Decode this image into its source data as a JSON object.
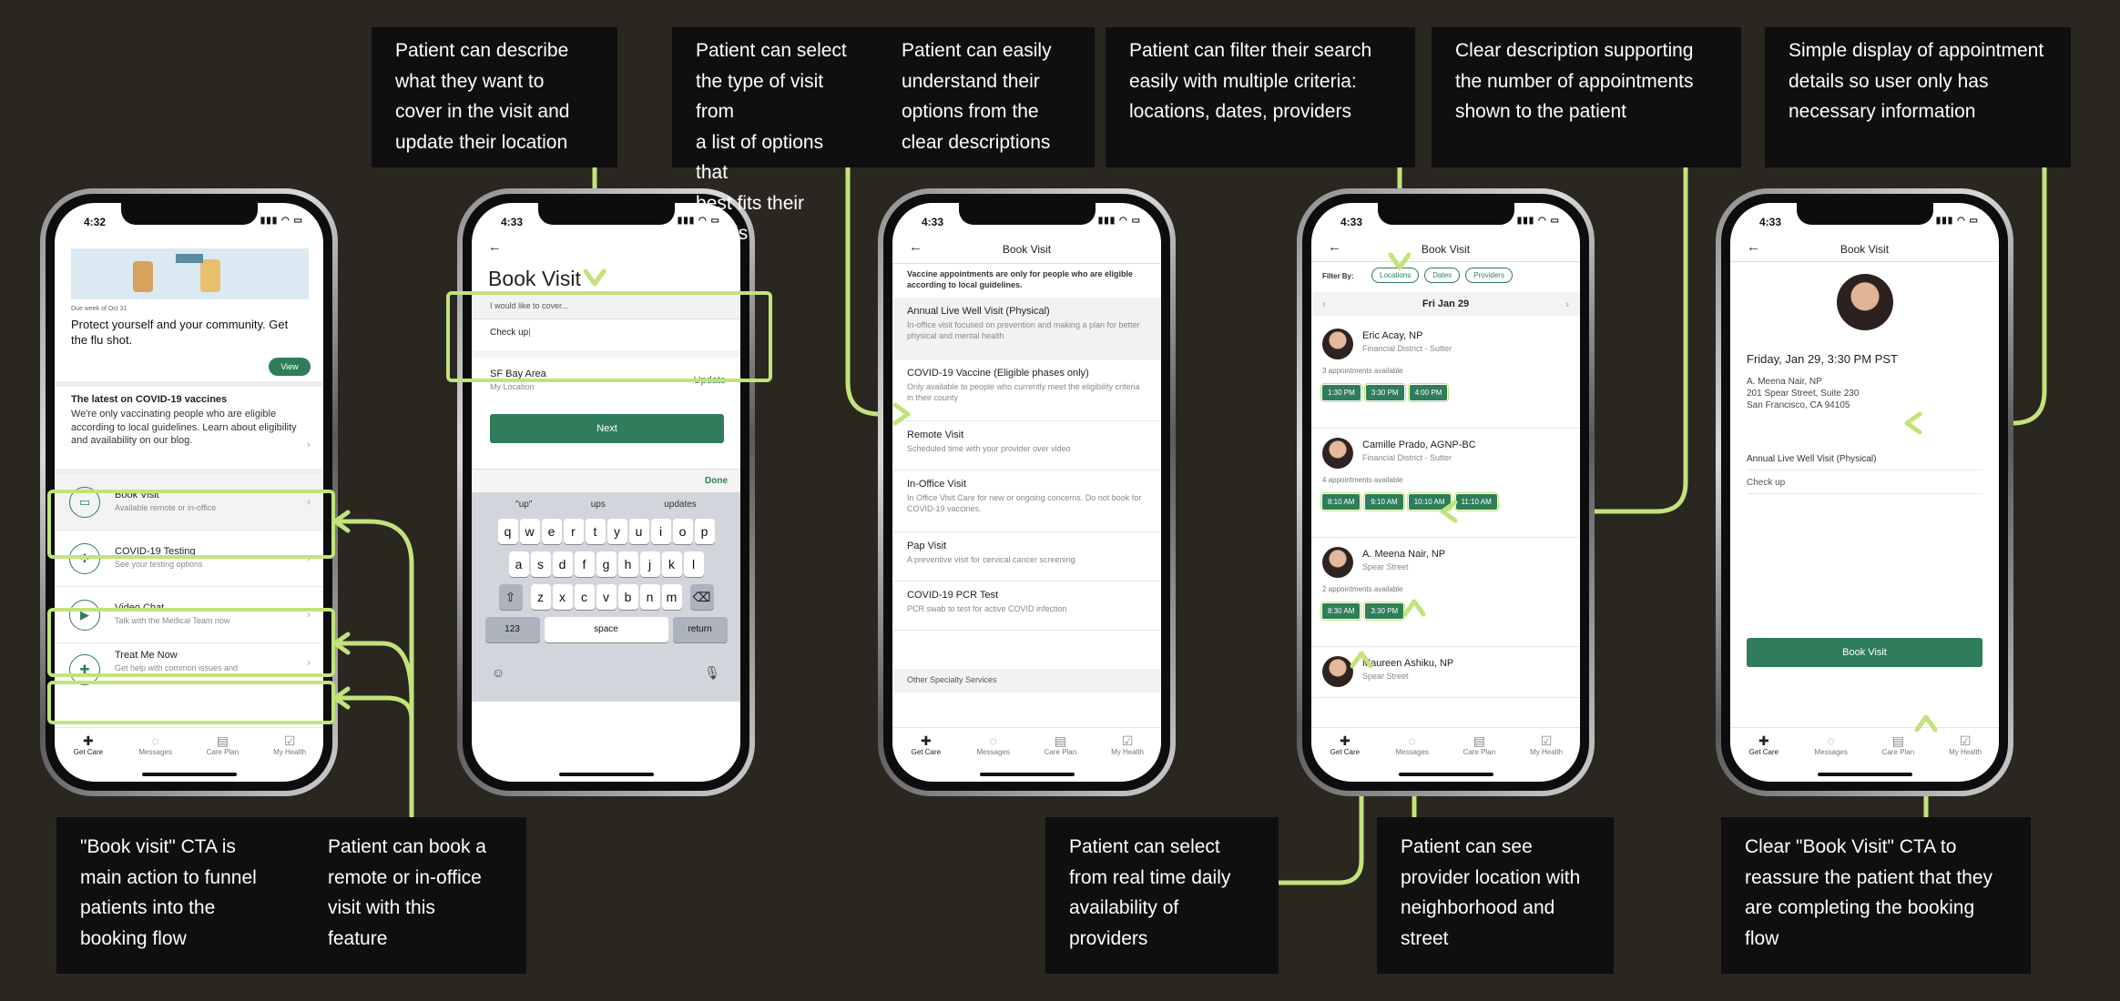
{
  "colors": {
    "background": "#2a2620",
    "note_bg": "#0f0f0f",
    "accent_highlight": "#c2e37a",
    "brand_green": "#2f7d5b"
  },
  "notes": {
    "describe": "Patient can describe\nwhat they want to\ncover in the visit and\nupdate their location",
    "select_type": "Patient can select\nthe type of visit from\na list of options that\nbest fits their needs",
    "understand": "Patient can easily\nunderstand their\noptions from the\nclear descriptions",
    "filter": "Patient can filter their search\neasily with multiple criteria:\nlocations, dates, providers",
    "clear_desc": "Clear description supporting\nthe number of appointments\nshown to the patient",
    "simple_display": "Simple display of appointment\ndetails so user only has\nnecessary information",
    "cta_main": "\"Book visit\" CTA is\nmain action to funnel\npatients into the\nbooking flow",
    "book_remote": "Patient can book a\nremote or in-office\nvisit with this\nfeature",
    "realtime": "Patient can select\nfrom real time daily\navailability of\nproviders",
    "provider_loc": "Patient can see\nprovider location with\nneighborhood and\nstreet",
    "clear_cta": "Clear \"Book Visit\" CTA to\nreassure the patient that they\nare completing the booking\nflow"
  },
  "tabs": [
    {
      "label": "Get Care",
      "icon": "medkit-icon"
    },
    {
      "label": "Messages",
      "icon": "chat-icon"
    },
    {
      "label": "Care Plan",
      "icon": "clipboard-icon"
    },
    {
      "label": "My Health",
      "icon": "health-icon"
    }
  ],
  "screen1": {
    "time": "4:32",
    "due": "Due week of Oct 31",
    "promo": "Protect yourself and your community. Get the flu shot.",
    "view": "View",
    "covid_title": "The latest on COVID-19 vaccines",
    "covid_body": "We're only vaccinating people who are eligible according to local guidelines. Learn about eligibility and availability on our blog.",
    "items": [
      {
        "title": "Book Visit",
        "sub": "Available remote or in-office",
        "icon": "calendar-icon"
      },
      {
        "title": "COVID-19 Testing",
        "sub": "See your testing options",
        "icon": "virus-icon"
      },
      {
        "title": "Video Chat",
        "sub": "Talk with the Medical Team now",
        "icon": "video-icon"
      },
      {
        "title": "Treat Me Now",
        "sub": "Get help with common issues and",
        "icon": "medkit-icon"
      }
    ]
  },
  "screen2": {
    "time": "4:33",
    "title": "Book Visit",
    "cover_placeholder": "I would like to cover...",
    "cover_value": "Check up",
    "location_title": "SF Bay Area",
    "location_sub": "My Location",
    "update": "Update",
    "next": "Next",
    "done": "Done",
    "suggestions": [
      "\"up\"",
      "ups",
      "updates"
    ],
    "keys_row1": [
      "q",
      "w",
      "e",
      "r",
      "t",
      "y",
      "u",
      "i",
      "o",
      "p"
    ],
    "keys_row2": [
      "a",
      "s",
      "d",
      "f",
      "g",
      "h",
      "j",
      "k",
      "l"
    ],
    "keys_row3": [
      "z",
      "x",
      "c",
      "v",
      "b",
      "n",
      "m"
    ],
    "key_123": "123",
    "key_space": "space",
    "key_return": "return"
  },
  "screen3": {
    "time": "4:33",
    "title": "Book Visit",
    "notice": "Vaccine appointments are only for people who are eligible according to local guidelines.",
    "options": [
      {
        "title": "Annual Live Well Visit (Physical)",
        "desc": "In-office visit focused on prevention and making a plan for better physical and mental health"
      },
      {
        "title": "COVID-19 Vaccine (Eligible phases only)",
        "desc": "Only available to people who currently meet the eligibility criteria in their county"
      },
      {
        "title": "Remote Visit",
        "desc": "Scheduled time with your provider over video"
      },
      {
        "title": "In-Office Visit",
        "desc": "In Office Visit Care for new or ongoing concerns. Do not book for COVID-19 vaccines."
      },
      {
        "title": "Pap Visit",
        "desc": "A preventive visit for cervical cancer screening"
      },
      {
        "title": "COVID-19 PCR Test",
        "desc": "PCR swab to test for active COVID infection"
      }
    ],
    "other": "Other Specialty Services"
  },
  "screen4": {
    "time": "4:33",
    "title": "Book Visit",
    "filter_by": "Filter By:",
    "filters": [
      "Locations",
      "Dates",
      "Providers"
    ],
    "date": "Fri Jan 29",
    "providers": [
      {
        "name": "Eric Acay, NP",
        "loc": "Financial District - Sutter",
        "avail": "3 appointments available",
        "slots": [
          "1:30 PM",
          "3:30 PM",
          "4:00 PM"
        ]
      },
      {
        "name": "Camille Prado, AGNP-BC",
        "loc": "Financial District - Sutter",
        "avail": "4 appointments available",
        "slots": [
          "8:10 AM",
          "9:10 AM",
          "10:10 AM",
          "11:10 AM"
        ]
      },
      {
        "name": "A. Meena Nair, NP",
        "loc": "Spear Street",
        "avail": "2 appointments available",
        "slots": [
          "8:30 AM",
          "3:30 PM"
        ]
      },
      {
        "name": "Maureen Ashiku, NP",
        "loc": "Spear Street",
        "avail": "",
        "slots": []
      }
    ]
  },
  "screen5": {
    "time": "4:33",
    "title": "Book Visit",
    "datetime": "Friday, Jan 29, 3:30 PM PST",
    "provider": "A. Meena Nair, NP",
    "address1": "201 Spear Street, Suite 230",
    "address2": "San Francisco, CA 94105",
    "visit_type": "Annual Live Well Visit (Physical)",
    "reason": "Check up",
    "book": "Book Visit"
  }
}
